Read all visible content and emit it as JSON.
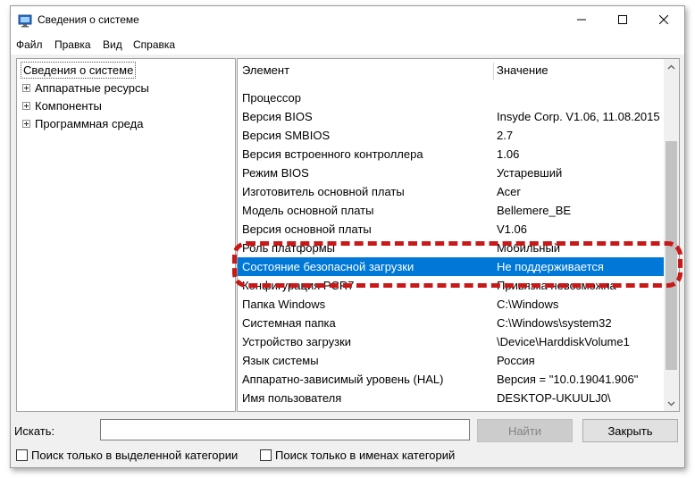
{
  "window": {
    "title": "Сведения о системе"
  },
  "menu": [
    "Файл",
    "Правка",
    "Вид",
    "Справка"
  ],
  "tree": {
    "root": "Сведения о системе",
    "children": [
      "Аппаратные ресурсы",
      "Компоненты",
      "Программная среда"
    ]
  },
  "table": {
    "headers": {
      "name": "Элемент",
      "value": "Значение"
    },
    "rows": [
      {
        "name": "Процессор",
        "value": ""
      },
      {
        "name": "Версия BIOS",
        "value": "Insyde Corp. V1.06, 11.08.2015"
      },
      {
        "name": "Версия SMBIOS",
        "value": "2.7"
      },
      {
        "name": "Версия встроенного контроллера",
        "value": "1.06"
      },
      {
        "name": "Режим BIOS",
        "value": "Устаревший"
      },
      {
        "name": "Изготовитель основной платы",
        "value": "Acer"
      },
      {
        "name": "Модель основной платы",
        "value": "Bellemere_BE"
      },
      {
        "name": "Версия основной платы",
        "value": "V1.06"
      },
      {
        "name": "Роль платформы",
        "value": "Мобильный"
      },
      {
        "name": "Состояние безопасной загрузки",
        "value": "Не поддерживается"
      },
      {
        "name": "Конфигурация PCR7",
        "value": "Привязка невозможна"
      },
      {
        "name": "Папка Windows",
        "value": "C:\\Windows"
      },
      {
        "name": "Системная папка",
        "value": "C:\\Windows\\system32"
      },
      {
        "name": "Устройство загрузки",
        "value": "\\Device\\HarddiskVolume1"
      },
      {
        "name": "Язык системы",
        "value": "Россия"
      },
      {
        "name": "Аппаратно-зависимый уровень (HAL)",
        "value": "Версия = \"10.0.19041.906\""
      },
      {
        "name": "Имя пользователя",
        "value": "DESKTOP-UKUULJ0\\"
      }
    ],
    "selected_index": 9
  },
  "search": {
    "label": "Искать:",
    "value": "",
    "find_button": "Найти",
    "close_button": "Закрыть",
    "options": [
      "Поиск только в выделенной категории",
      "Поиск только в именах категорий"
    ]
  },
  "colors": {
    "selection": "#0078d7",
    "highlight_ring": "#c81818"
  }
}
